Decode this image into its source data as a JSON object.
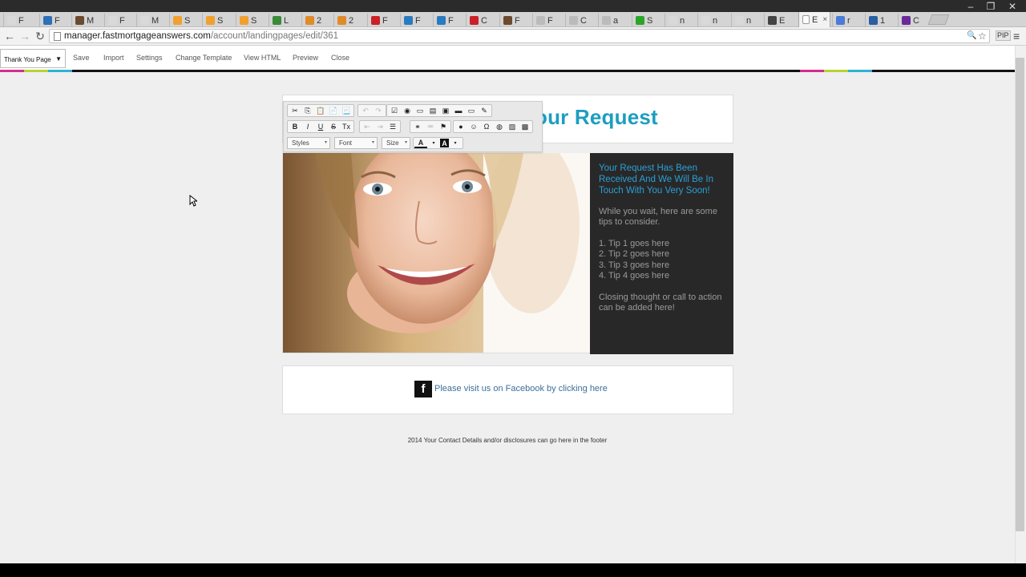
{
  "browser": {
    "tabs": [
      {
        "letter": "F",
        "color": "#d9d9d9"
      },
      {
        "letter": "F",
        "color": "#2f6fb5"
      },
      {
        "letter": "M",
        "color": "#6b4a2e"
      },
      {
        "letter": "F",
        "color": "#d9d9d9"
      },
      {
        "letter": "M",
        "color": "#d9d9d9"
      },
      {
        "letter": "S",
        "color": "#f0a030"
      },
      {
        "letter": "S",
        "color": "#f0a030"
      },
      {
        "letter": "S",
        "color": "#f0a030"
      },
      {
        "letter": "L",
        "color": "#3a8a3a"
      },
      {
        "letter": "2",
        "color": "#e08a2a"
      },
      {
        "letter": "2",
        "color": "#e08a2a"
      },
      {
        "letter": "F",
        "color": "#cb2027"
      },
      {
        "letter": "F",
        "color": "#2a7abf"
      },
      {
        "letter": "F",
        "color": "#2a7abf"
      },
      {
        "letter": "C",
        "color": "#cb2027"
      },
      {
        "letter": "F",
        "color": "#6b4a2e"
      },
      {
        "letter": "F",
        "color": "#bbbbbb"
      },
      {
        "letter": "C",
        "color": "#bbbbbb"
      },
      {
        "letter": "a",
        "color": "#bbbbbb"
      },
      {
        "letter": "S",
        "color": "#2aa52a"
      },
      {
        "letter": "n",
        "color": "#d9d9d9"
      },
      {
        "letter": "n",
        "color": "#d9d9d9"
      },
      {
        "letter": "n",
        "color": "#d9d9d9"
      },
      {
        "letter": "E",
        "color": "#444444"
      }
    ],
    "active_tab": {
      "letter": "E",
      "close": "×"
    },
    "after_tabs": [
      {
        "letter": "r",
        "color": "#4a7bd6"
      },
      {
        "letter": "1",
        "color": "#2a5fa0"
      },
      {
        "letter": "C",
        "color": "#6b2a9a"
      }
    ],
    "window_controls": {
      "minimize": "–",
      "restore": "❐",
      "close": "✕"
    },
    "nav": {
      "back": "←",
      "forward": "→",
      "reload": "↻"
    },
    "url_host": "manager.fastmortgageanswers.com",
    "url_path": "/account/landingpages/edit/361",
    "omni_icons": {
      "zoom": "🔍",
      "star": "☆"
    },
    "extension_label": "PIP",
    "menu_icon": "≡"
  },
  "toolbar": {
    "template_select": "Thank You Page",
    "select_arrow": "▼",
    "save": "Save",
    "import": "Import",
    "settings": "Settings",
    "change_template": "Change Template",
    "view_html": "View HTML",
    "preview": "Preview",
    "close": "Close"
  },
  "colors": {
    "accent_teal": "#1c9ec0",
    "heading_blue": "#2aa0d6",
    "panel_dark": "#282828",
    "link_blue": "#3b6f9a",
    "bar_magenta": "#d12e8c",
    "bar_lime": "#b8d232",
    "bar_cyan": "#2fb2d2"
  },
  "editor_toolbar": {
    "row1": [
      {
        "name": "cut-icon",
        "glyph": "✂"
      },
      {
        "name": "copy-icon",
        "glyph": "⎘"
      },
      {
        "name": "paste-icon",
        "glyph": "📋"
      },
      {
        "name": "paste-text-icon",
        "glyph": "📄"
      },
      {
        "name": "paste-word-icon",
        "glyph": "📃"
      }
    ],
    "row1_undo": [
      {
        "name": "undo-icon",
        "glyph": "↶"
      },
      {
        "name": "redo-icon",
        "glyph": "↷"
      }
    ],
    "row1_forms": [
      {
        "name": "checkbox-icon",
        "glyph": "☑"
      },
      {
        "name": "radio-icon",
        "glyph": "◉"
      },
      {
        "name": "textfield-icon",
        "glyph": "▭"
      },
      {
        "name": "textarea-icon",
        "glyph": "▤"
      },
      {
        "name": "select-icon",
        "glyph": "▣"
      },
      {
        "name": "button-icon",
        "glyph": "▬"
      },
      {
        "name": "image-button-icon",
        "glyph": "▭"
      },
      {
        "name": "hidden-field-icon",
        "glyph": "✎"
      }
    ],
    "row2_format": [
      {
        "name": "bold-icon",
        "glyph": "B"
      },
      {
        "name": "italic-icon",
        "glyph": "I"
      },
      {
        "name": "underline-icon",
        "glyph": "U"
      },
      {
        "name": "strike-icon",
        "glyph": "S"
      },
      {
        "name": "remove-format-icon",
        "glyph": "Tx"
      }
    ],
    "row2_indent": [
      {
        "name": "outdent-icon",
        "glyph": "⇤"
      },
      {
        "name": "indent-icon",
        "glyph": "⇥"
      },
      {
        "name": "align-icon",
        "glyph": "☰"
      }
    ],
    "row2_links": [
      {
        "name": "link-icon",
        "glyph": "⚭"
      },
      {
        "name": "unlink-icon",
        "glyph": "⚮"
      },
      {
        "name": "anchor-icon",
        "glyph": "⚑"
      }
    ],
    "row2_insert": [
      {
        "name": "flash-icon",
        "glyph": "●"
      },
      {
        "name": "smiley-icon",
        "glyph": "☺"
      },
      {
        "name": "special-char-icon",
        "glyph": "Ω"
      },
      {
        "name": "iframe-icon",
        "glyph": "◍"
      },
      {
        "name": "image-icon",
        "glyph": "▨"
      },
      {
        "name": "media-icon",
        "glyph": "▩"
      }
    ],
    "styles": "Styles",
    "font": "Font",
    "size": "Size",
    "text_color": "A",
    "bg_color": "A",
    "combo_arrow": "▾"
  },
  "page": {
    "headline": "our Request",
    "panel_heading": "Your Request Has Been Received And We Will Be In Touch With You Very Soon!",
    "panel_intro": "While you wait, here are some tips to consider.",
    "tips": [
      "1. Tip 1 goes here",
      "2. Tip 2 goes here",
      "3. Tip 3 goes here",
      "4. Tip 4 goes here"
    ],
    "closing": "Closing thought or call to action can be added here!",
    "fb_letter": "f",
    "fb_link": "Please visit us on Facebook by clicking here",
    "footer": "2014 Your Contact Details and/or disclosures can go here in the footer"
  }
}
